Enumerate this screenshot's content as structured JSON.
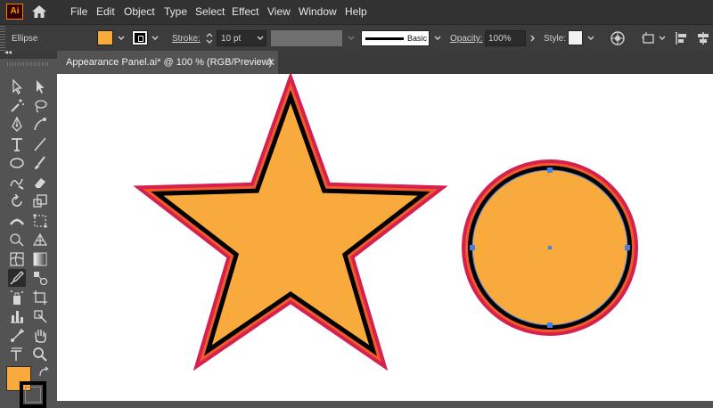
{
  "app": {
    "logo_text": "Ai"
  },
  "menu": {
    "items": [
      "File",
      "Edit",
      "Object",
      "Type",
      "Select",
      "Effect",
      "View",
      "Window",
      "Help"
    ]
  },
  "control_bar": {
    "selection_type": "Ellipse",
    "fill_color": "#f9aa3c",
    "stroke_label": "Stroke:",
    "stroke_weight": "10 pt",
    "profile_label": "Basic",
    "opacity_label": "Opacity:",
    "opacity_value": "100%",
    "style_label": "Style:"
  },
  "document_tab": {
    "title": "Appearance Panel.ai* @ 100 % (RGB/Preview)",
    "close_glyph": "✕"
  },
  "toolbar": {
    "tools": [
      "selection-tool",
      "direct-selection-tool",
      "magic-wand-tool",
      "lasso-tool",
      "pen-tool",
      "curvature-tool",
      "type-tool",
      "line-segment-tool",
      "ellipse-tool",
      "paintbrush-tool",
      "shaper-tool",
      "eraser-tool",
      "rotate-tool",
      "scale-tool",
      "width-tool",
      "free-transform-tool",
      "shape-builder-tool",
      "perspective-grid-tool",
      "mesh-tool",
      "gradient-tool",
      "eyedropper-tool",
      "blend-tool",
      "symbol-sprayer-tool",
      "artboard-tool",
      "column-graph-tool",
      "slice-tool",
      "hand-tool-alt",
      "hand-tool",
      "zoom-tool",
      "magnifier-tool"
    ],
    "active_tool": "eyedropper-tool",
    "fill_swatch": "#f9aa3c",
    "stroke_swatch": "#000000"
  },
  "artwork": {
    "fill_color": "#f9aa3c",
    "outer_stroke": "#d6204e",
    "middle_stroke": "#f15a29",
    "inner_stroke": "#000000",
    "selection_color": "#4a7fe0"
  }
}
